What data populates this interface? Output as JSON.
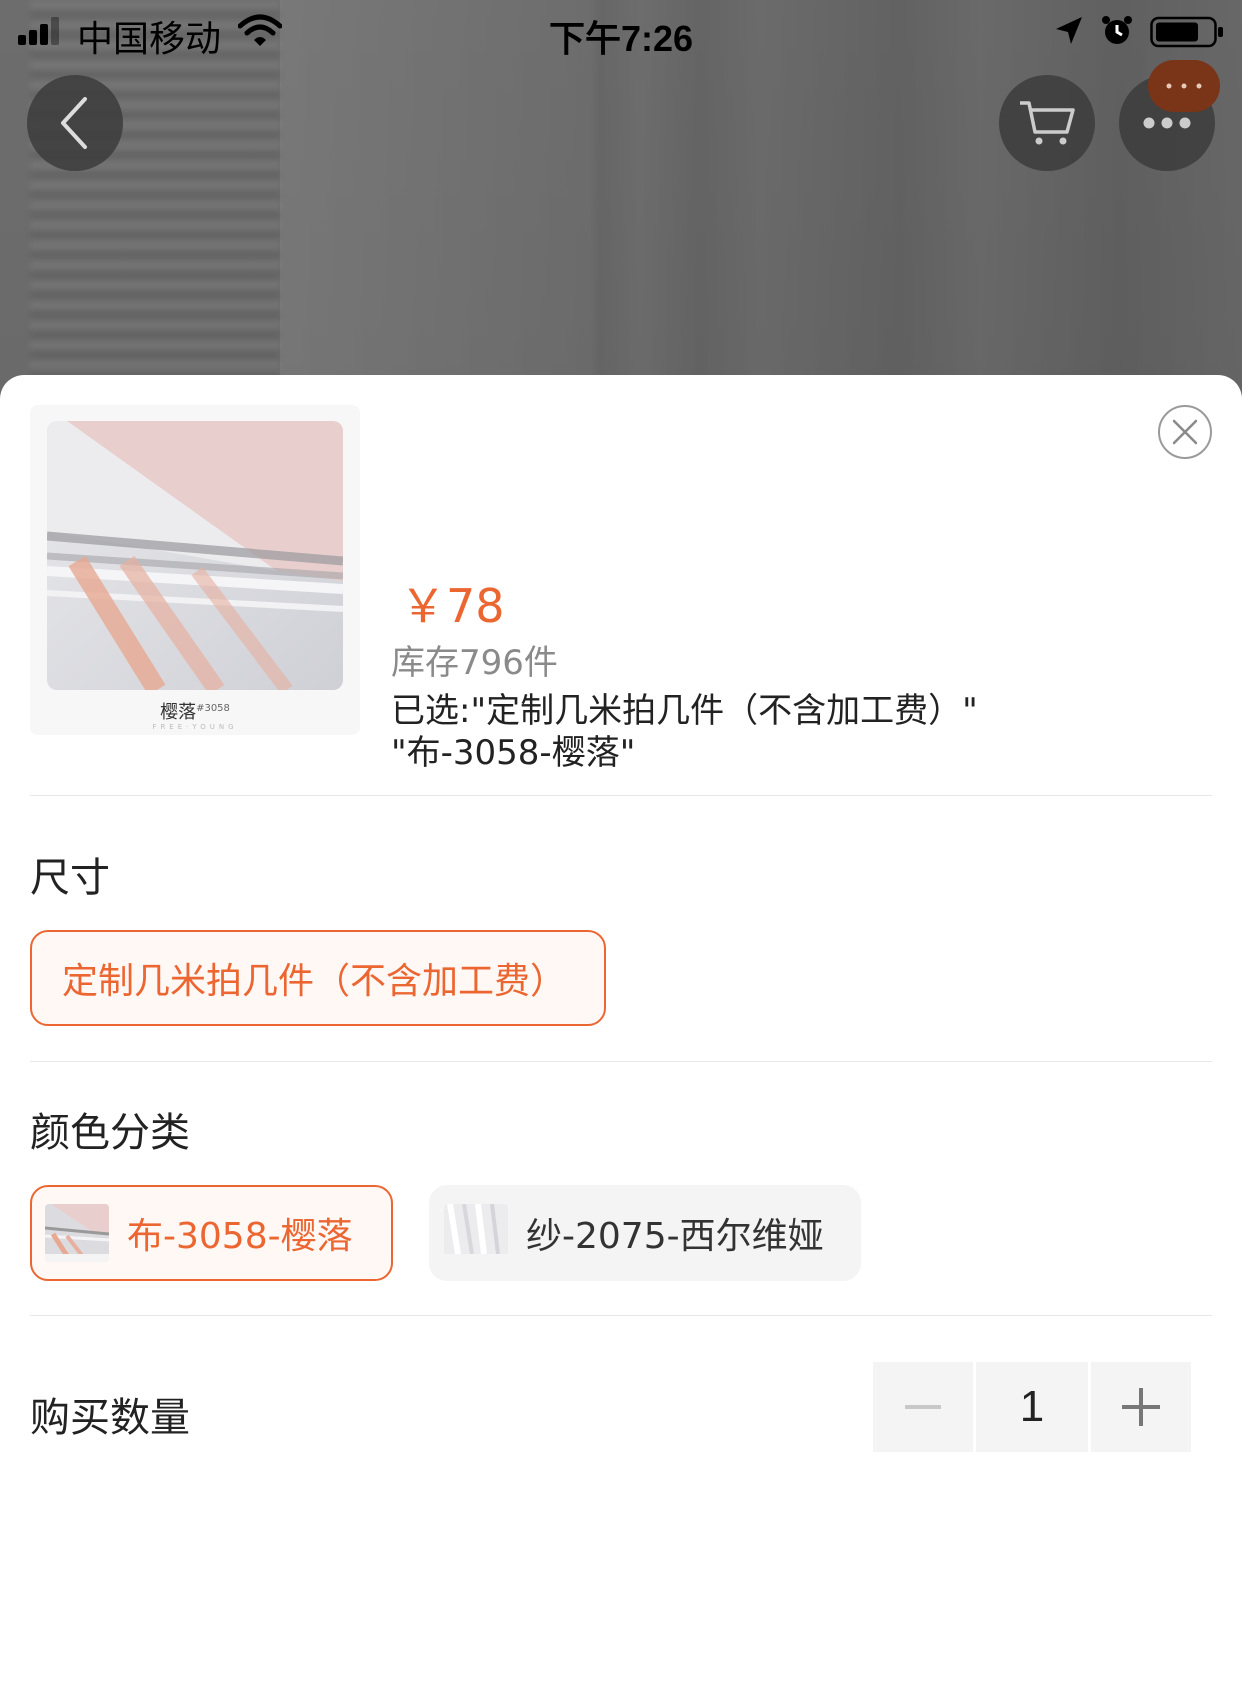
{
  "status_bar": {
    "carrier": "中国移动",
    "time": "下午7:26"
  },
  "nav": {
    "back_icon": "chevron-left-icon",
    "cart_icon": "cart-icon",
    "more_icon": "more-dots-icon"
  },
  "product": {
    "image_caption": "樱落",
    "image_caption_code": "#3058",
    "image_brand": "FREE·YOUNG",
    "price": "￥78",
    "stock": "库存796件",
    "selected_line1": "已选:\"定制几米拍几件（不含加工费）\"",
    "selected_line2": "\"布-3058-樱落\""
  },
  "size": {
    "title": "尺寸",
    "options": [
      {
        "label": "定制几米拍几件（不含加工费）",
        "selected": true
      }
    ]
  },
  "color": {
    "title": "颜色分类",
    "options": [
      {
        "label": "布-3058-樱落",
        "selected": true
      },
      {
        "label": "纱-2075-西尔维娅",
        "selected": false
      }
    ]
  },
  "quantity": {
    "title": "购买数量",
    "value": "1",
    "minus": "−",
    "plus": "+"
  },
  "colors": {
    "accent": "#ec6632",
    "accent_bg": "#fff8f5",
    "chip_bg": "#f4f4f4",
    "divider": "#e8e8e8"
  }
}
